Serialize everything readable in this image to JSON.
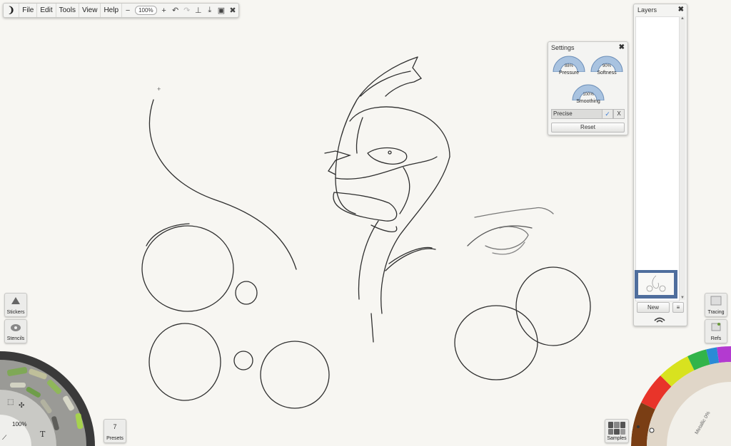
{
  "menubar": {
    "logo_icon": "artrage-logo-icon",
    "menus": [
      "File",
      "Edit",
      "Tools",
      "View",
      "Help"
    ],
    "zoom_out": "−",
    "zoom_value": "100%",
    "zoom_in": "+",
    "tools": [
      "undo-icon",
      "redo-icon",
      "canvas-position-icon",
      "import-icon",
      "reference-icon",
      "close-x-icon"
    ]
  },
  "layers": {
    "title": "Layers",
    "close": "✖",
    "new_label": "New",
    "menu_icon": "≡"
  },
  "settings": {
    "title": "Settings",
    "close": "✖",
    "pressure_value": "88%",
    "pressure_label": "Pressure",
    "softness_value": "90%",
    "softness_label": "Softness",
    "smoothing_value": "100%",
    "smoothing_label": "Smoothing",
    "preset": "Precise",
    "check": "✓",
    "cancel": "X",
    "reset_label": "Reset"
  },
  "left_panel": {
    "stickers_label": "Stickers",
    "stencils_label": "Stencils",
    "zoom_value": "100%",
    "text_tool": "T",
    "presets_count": "7",
    "presets_label": "Presets"
  },
  "right_panel": {
    "tracing_label": "Tracing",
    "refs_label": "Refs",
    "samples_label": "Samples",
    "metallic_label": "Metallic 0%"
  },
  "colors": {
    "ink": "#2b2b2b",
    "accent": "#4f6e9d",
    "panel_bg": "#f4f4f2",
    "canvas_bg": "#f7f6f2"
  }
}
